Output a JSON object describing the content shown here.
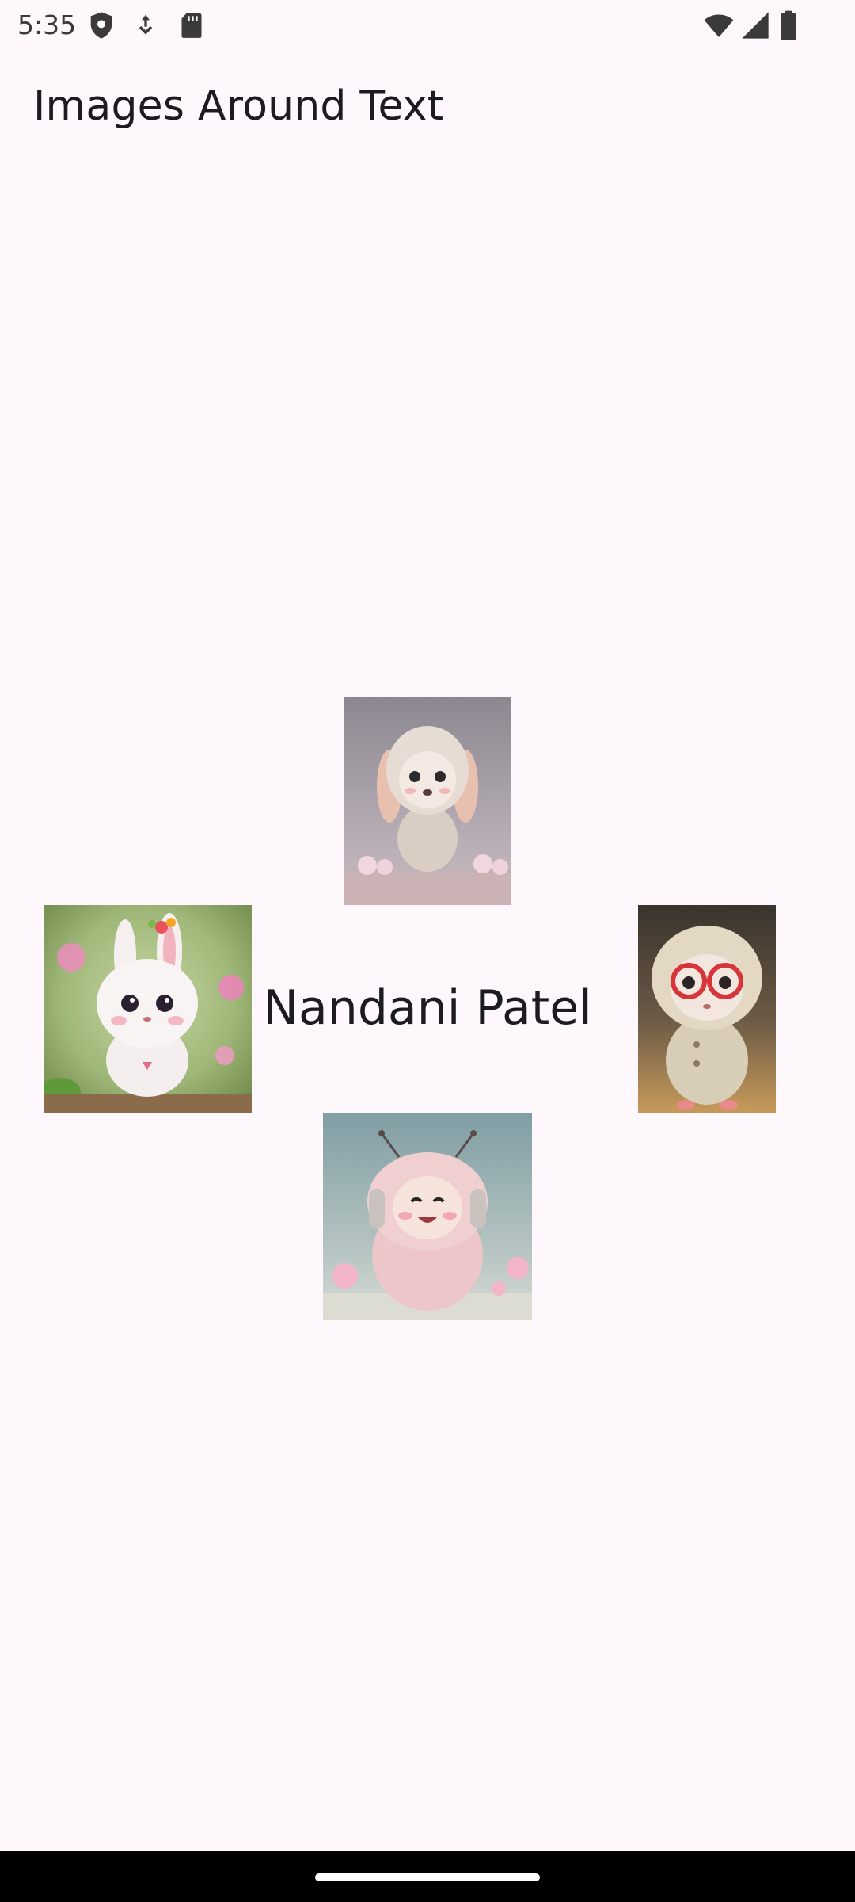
{
  "status_bar": {
    "time": "5:35",
    "left_icons": [
      "shield-icon",
      "download-icon",
      "sd-card-icon"
    ],
    "right_icons": [
      "wifi-icon",
      "cellular-signal-icon",
      "battery-icon"
    ]
  },
  "app_bar": {
    "title": "Images Around Text"
  },
  "content": {
    "center_text": "Nandani Patel",
    "images": [
      {
        "position": "top",
        "subject": "bunny in beige hoodie"
      },
      {
        "position": "left",
        "subject": "white bunny with flower crown"
      },
      {
        "position": "right",
        "subject": "bunny with red glasses in knitted coat"
      },
      {
        "position": "bottom",
        "subject": "pink fluffy creature with headphones"
      }
    ]
  },
  "nav_bar": {
    "home_indicator": "home-gesture-pill"
  }
}
